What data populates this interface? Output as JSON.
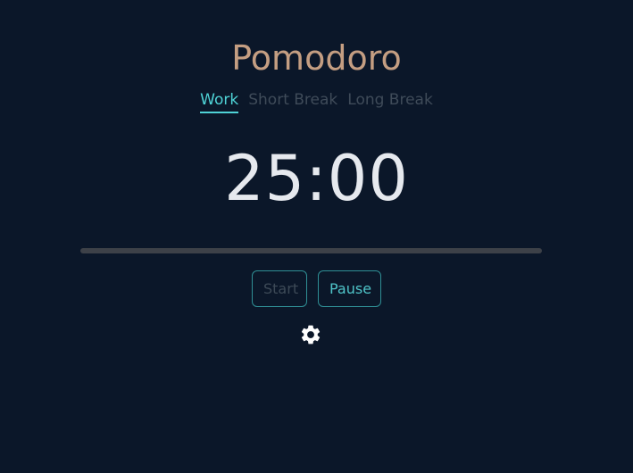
{
  "app": {
    "title": "Pomodoro"
  },
  "tabs": [
    {
      "label": "Work",
      "active": true
    },
    {
      "label": "Short Break",
      "active": false
    },
    {
      "label": "Long Break",
      "active": false
    }
  ],
  "timer": {
    "display": "25:00"
  },
  "progress": {
    "fraction": 0
  },
  "controls": {
    "start_label": "Start",
    "pause_label": "Pause"
  },
  "settings": {
    "icon": "gear-icon"
  },
  "colors": {
    "background": "#0b1729",
    "title": "#c49e82",
    "accent": "#4fd3d6",
    "inactive_tab": "#3f4b59",
    "timer_text": "#e6e9ee",
    "progress_track": "#3d4148"
  }
}
